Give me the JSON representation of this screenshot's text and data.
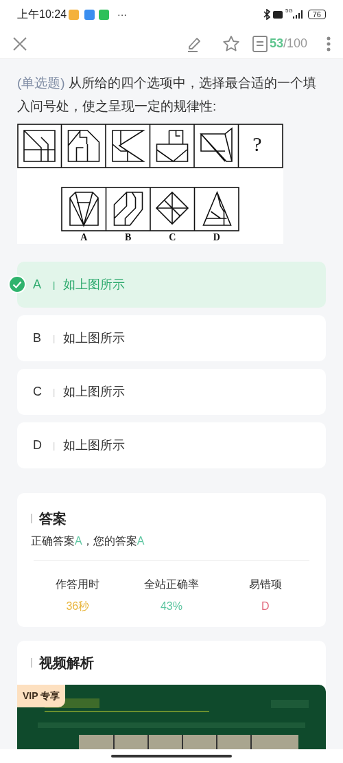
{
  "status_bar": {
    "time": "上午10:24",
    "more": "···",
    "network": "5G",
    "battery": "76"
  },
  "toolbar": {
    "progress_current": "53",
    "progress_total": "/100"
  },
  "question": {
    "type_label": "(单选题)",
    "text": "从所给的四个选项中，选择最合适的一个填入问号处，使之呈现一定的规律性:",
    "figure": {
      "question_mark": "?",
      "option_labels": [
        "A",
        "B",
        "C",
        "D"
      ]
    }
  },
  "options": [
    {
      "letter": "A",
      "separator": "|",
      "text": "如上图所示",
      "selected": true
    },
    {
      "letter": "B",
      "separator": "|",
      "text": "如上图所示",
      "selected": false
    },
    {
      "letter": "C",
      "separator": "|",
      "text": "如上图所示",
      "selected": false
    },
    {
      "letter": "D",
      "separator": "|",
      "text": "如上图所示",
      "selected": false
    }
  ],
  "answer": {
    "title": "答案",
    "correct_prefix": "正确答案",
    "correct": "A",
    "your_prefix": "，您的答案",
    "your": "A",
    "stats": [
      {
        "label": "作答用时",
        "value": "36秒",
        "color": "#e8b53c"
      },
      {
        "label": "全站正确率",
        "value": "43%",
        "color": "#5cc5a0"
      },
      {
        "label": "易错项",
        "value": "D",
        "color": "#e26a7e"
      }
    ]
  },
  "video": {
    "title": "视频解析",
    "badge": "VIP 专享",
    "kind": "picture"
  }
}
